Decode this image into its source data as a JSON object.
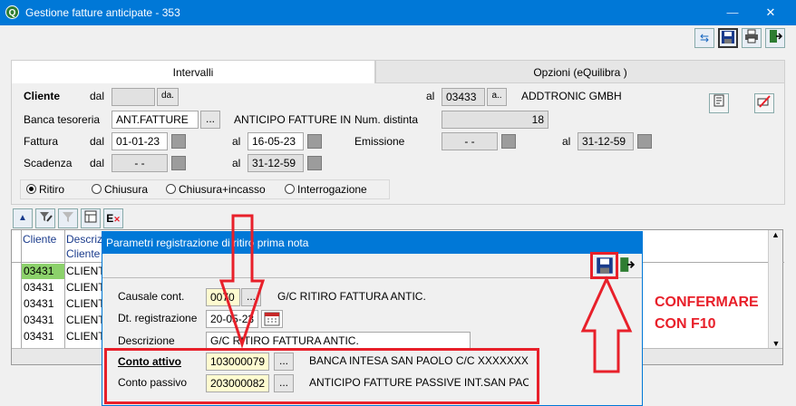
{
  "window": {
    "title": "Gestione fatture anticipate - 353",
    "app_icon": "Q",
    "minimize": "—",
    "maximize": "☐",
    "close": "✕"
  },
  "toolbar": {
    "refresh_icon": "⇆",
    "save_icon": "💾",
    "print_icon": "🖶",
    "exit_icon": "⇥"
  },
  "tabs": [
    {
      "label": "Intervalli"
    },
    {
      "label": "Opzioni (eQuilibra )"
    }
  ],
  "form": {
    "cliente_label": "Cliente",
    "dal": "dal",
    "al": "al",
    "cliente_dal_value": "",
    "cliente_dal_btn": "da.",
    "cliente_al_value": "03433",
    "cliente_al_btn": "a..",
    "cliente_al_name": "ADDTRONIC GMBH",
    "banca_label": "Banca tesoreria",
    "banca_value": "ANT.FATTURE",
    "banca_desc": "ANTICIPO FATTURE IN",
    "num_distinta_label": "Num. distinta",
    "num_distinta_value": "18",
    "fattura_label": "Fattura",
    "fattura_dal": "01-01-23",
    "fattura_al": "16-05-23",
    "emissione_label": "Emissione",
    "emissione_dal": "- -",
    "emissione_al": "31-12-59",
    "scadenza_label": "Scadenza",
    "scadenza_dal": "- -",
    "scadenza_al": "31-12-59"
  },
  "radios": [
    {
      "label": "Ritiro",
      "selected": true
    },
    {
      "label": "Chiusura",
      "selected": false
    },
    {
      "label": "Chiusura+incasso",
      "selected": false
    },
    {
      "label": "Interrogazione",
      "selected": false
    }
  ],
  "grid": {
    "headers": [
      "Cliente",
      "Descriz",
      "Cliente"
    ],
    "rows": [
      {
        "cliente": "03431",
        "descr": "CLIENT"
      },
      {
        "cliente": "03431",
        "descr": "CLIENT"
      },
      {
        "cliente": "03431",
        "descr": "CLIENT"
      },
      {
        "cliente": "03431",
        "descr": "CLIENT"
      },
      {
        "cliente": "03431",
        "descr": "CLIENT"
      }
    ]
  },
  "dialog": {
    "title": "Parametri registrazione di ritiro prima nota",
    "causale_label": "Causale cont.",
    "causale_value": "0070",
    "causale_desc": "G/C RITIRO FATTURA ANTIC.",
    "dt_label": "Dt. registrazione",
    "dt_value": "20-05-23",
    "descrizione_label": "Descrizione",
    "descrizione_value": "G/C RITIRO FATTURA ANTIC.",
    "conto_attivo_label": "Conto attivo",
    "conto_attivo_value": "103000079",
    "conto_attivo_desc": "BANCA INTESA SAN PAOLO C/C XXXXXXXXX",
    "conto_passivo_label": "Conto passivo",
    "conto_passivo_value": "203000082",
    "conto_passivo_desc": "ANTICIPO FATTURE PASSIVE INT.SAN PAOL",
    "dots": "..."
  },
  "annotation": {
    "line1": "CONFERMARE",
    "line2": "CON F10",
    "color": "#e8202a"
  }
}
